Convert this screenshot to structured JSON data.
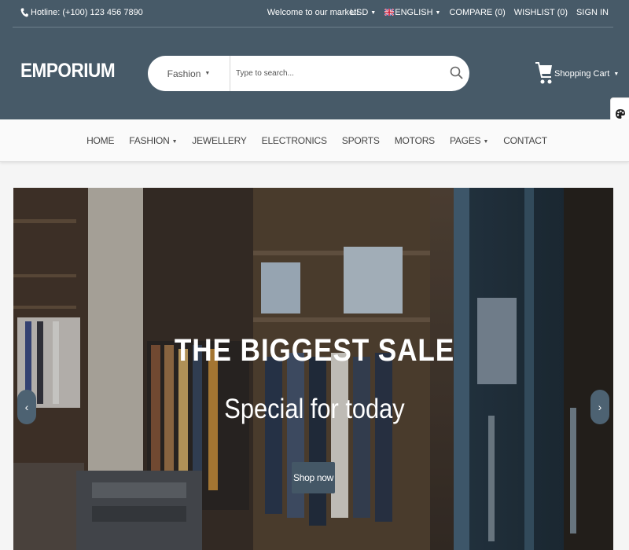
{
  "topbar": {
    "hotline": "Hotline: (+100) 123 456 7890",
    "welcome": "Welcome to our market!",
    "currency": "USD",
    "language": "ENGLISH",
    "compare": "COMPARE (0)",
    "wishlist": "WISHLIST (0)",
    "signin": "SIGN IN"
  },
  "header": {
    "logo": "EMPORIUM",
    "search_category": "Fashion",
    "search_placeholder": "Type to search...",
    "cart_label": "Shopping Cart"
  },
  "nav": {
    "items": [
      "HOME",
      "FASHION",
      "JEWELLERY",
      "ELECTRONICS",
      "SPORTS",
      "MOTORS",
      "PAGES",
      "CONTACT"
    ]
  },
  "slider": {
    "title": "THE BIGGEST SALE",
    "subtitle": "Special for today",
    "button": "Shop now",
    "prev_icon": "chevron-left-icon",
    "next_icon": "chevron-right-icon"
  },
  "colors": {
    "header_bg": "#475a68",
    "nav_bg": "#fafafa",
    "button_bg": "#445766",
    "arrow_bg": "#4d6272"
  }
}
